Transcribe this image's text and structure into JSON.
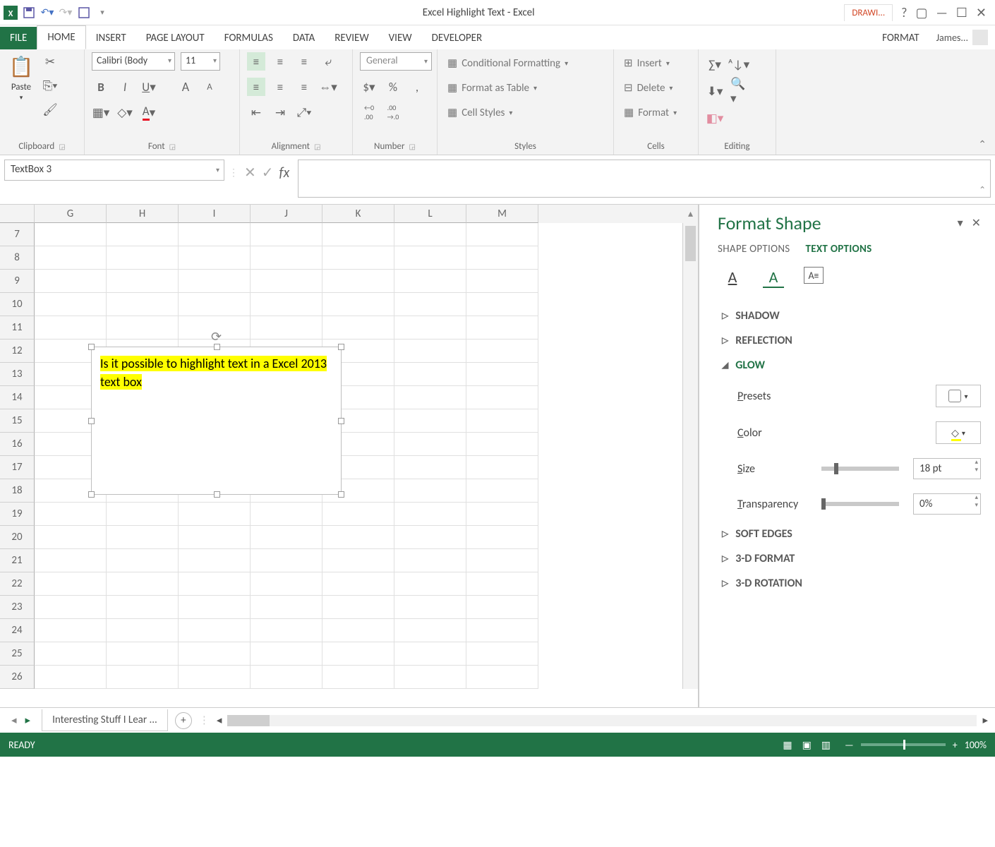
{
  "title": "Excel Highlight Text - Excel",
  "context_tab": "DRAWI...",
  "user": "James... ",
  "tabs": [
    "FILE",
    "HOME",
    "INSERT",
    "PAGE LAYOUT",
    "FORMULAS",
    "DATA",
    "REVIEW",
    "VIEW",
    "DEVELOPER",
    "FORMAT"
  ],
  "ribbon": {
    "clipboard": {
      "label": "Clipboard",
      "paste": "Paste"
    },
    "font": {
      "label": "Font",
      "name": "Calibri (Body",
      "size": "11"
    },
    "alignment": {
      "label": "Alignment"
    },
    "number": {
      "label": "Number",
      "format": "General"
    },
    "styles": {
      "label": "Styles",
      "cond": "Conditional Formatting",
      "table": "Format as Table",
      "cell": "Cell Styles"
    },
    "cells": {
      "label": "Cells",
      "insert": "Insert",
      "delete": "Delete",
      "format": "Format"
    },
    "editing": {
      "label": "Editing"
    }
  },
  "namebox": "TextBox 3",
  "columns": [
    "G",
    "H",
    "I",
    "J",
    "K",
    "L",
    "M"
  ],
  "row_start": 7,
  "row_end": 26,
  "textbox_text": "Is it possible to highlight text in a Excel 2013 text box",
  "pane": {
    "title": "Format Shape",
    "tabs": [
      "SHAPE OPTIONS",
      "TEXT OPTIONS"
    ],
    "sections": {
      "shadow": "SHADOW",
      "reflection": "REFLECTION",
      "glow": "GLOW",
      "soft": "SOFT EDGES",
      "fmt3d": "3-D FORMAT",
      "rot3d": "3-D ROTATION"
    },
    "glow": {
      "presets": "Presets",
      "color": "Color",
      "size_label": "Size",
      "size": "18 pt",
      "trans_label": "Transparency",
      "trans": "0%"
    }
  },
  "sheet_tab": "Interesting Stuff I Lear ...",
  "status": {
    "ready": "READY",
    "zoom": "100%"
  }
}
